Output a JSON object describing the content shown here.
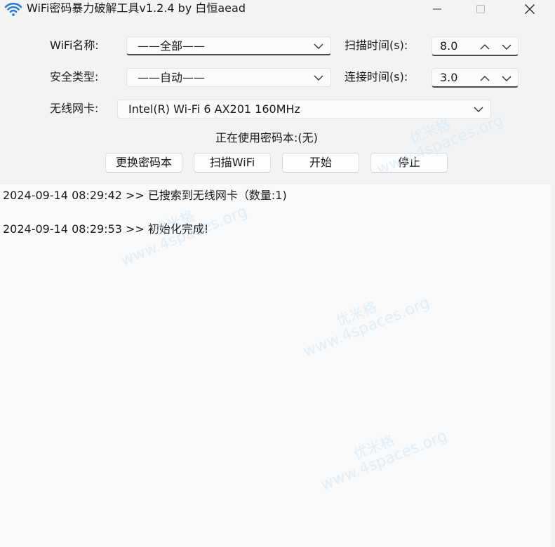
{
  "titlebar": {
    "title": "WiFi密码暴力破解工具v1.2.4 by 白恒aead",
    "app_icon": "wifi-icon",
    "controls": [
      "minimize-icon",
      "maximize-icon",
      "close-icon"
    ]
  },
  "form": {
    "wifi_name": {
      "label": "WiFi名称:",
      "value": "——全部——"
    },
    "security_type": {
      "label": "安全类型:",
      "value": "——自动——"
    },
    "adapter": {
      "label": "无线网卡:",
      "value": "Intel(R) Wi-Fi 6 AX201 160MHz"
    },
    "scan_time": {
      "label": "扫描时间(s):",
      "value": "8.0"
    },
    "connect_time": {
      "label": "连接时间(s):",
      "value": "3.0"
    }
  },
  "dictionary_status": "正在使用密码本:(无)",
  "buttons": {
    "change_dict": "更换密码本",
    "scan_wifi": "扫描WiFi",
    "start": "开始",
    "stop": "停止"
  },
  "log": [
    "2024-09-14 08:29:42 >> 已搜索到无线网卡（数量:1)",
    "2024-09-14 08:29:53 >> 初始化完成!"
  ],
  "watermark": {
    "brand": "优米格",
    "site": "www.4spaces.org"
  },
  "colors": {
    "wifi_icon": "#2b7cd3",
    "accent_underline": "#4a4a4a"
  }
}
